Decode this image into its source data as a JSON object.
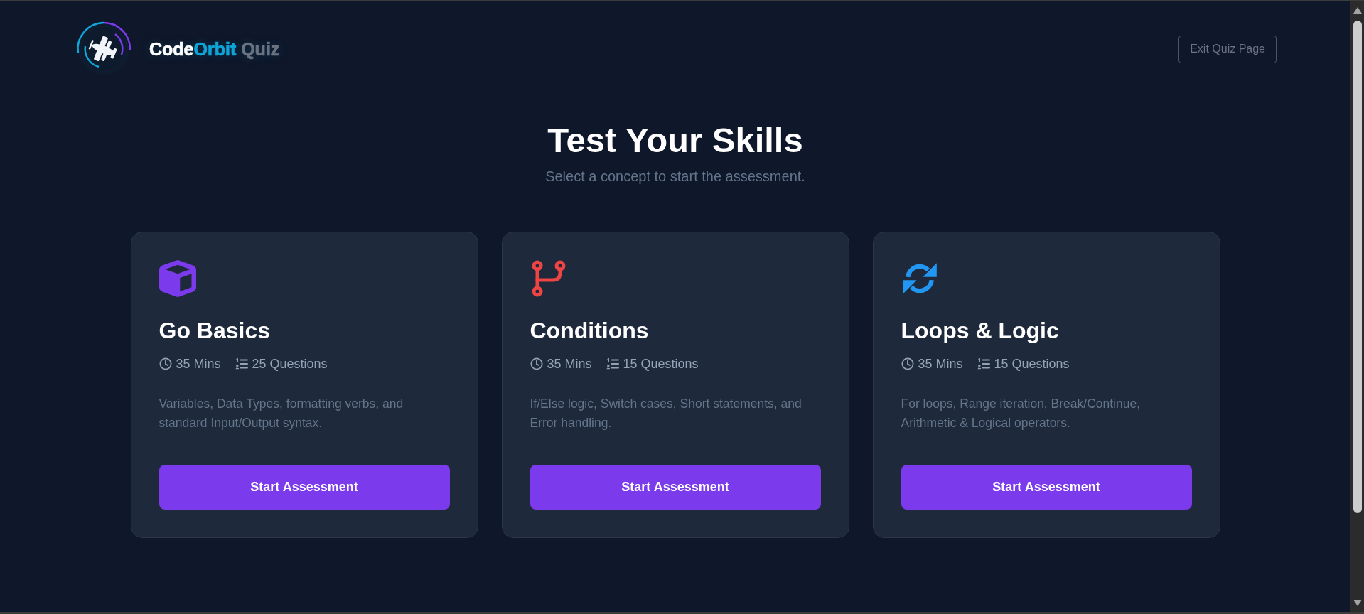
{
  "header": {
    "brand": {
      "name_parts": [
        "Code",
        "Orbit"
      ],
      "suffix": "Quiz"
    },
    "exit_button": "Exit Quiz Page"
  },
  "hero": {
    "title": "Test Your Skills",
    "subtitle": "Select a concept to start the assessment."
  },
  "cards": [
    {
      "title": "Go Basics",
      "color": "#7c3aed",
      "duration": "35 Mins",
      "questions": "25 Questions",
      "description": "Variables, Data Types, formatting verbs, and standard Input/Output syntax.",
      "button": "Start Assessment"
    },
    {
      "title": "Conditions",
      "color": "#ef4444",
      "duration": "35 Mins",
      "questions": "15 Questions",
      "description": "If/Else logic, Switch cases, Short statements, and Error handling.",
      "button": "Start Assessment"
    },
    {
      "title": "Loops & Logic",
      "color": "#2196f3",
      "duration": "35 Mins",
      "questions": "15 Questions",
      "description": "For loops, Range iteration, Break/Continue, Arithmetic & Logical operators.",
      "button": "Start Assessment"
    }
  ]
}
